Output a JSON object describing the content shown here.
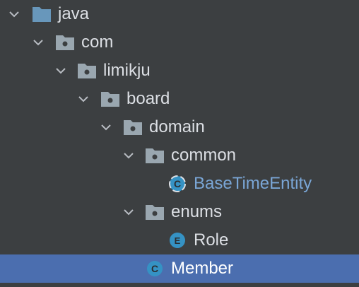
{
  "project_tree": {
    "nodes": [
      {
        "label": "java",
        "icon": "source-folder-icon",
        "expanded": true
      },
      {
        "label": "com",
        "icon": "package-icon",
        "expanded": true
      },
      {
        "label": "limikju",
        "icon": "package-icon",
        "expanded": true
      },
      {
        "label": "board",
        "icon": "package-icon",
        "expanded": true
      },
      {
        "label": "domain",
        "icon": "package-icon",
        "expanded": true
      },
      {
        "label": "common",
        "icon": "package-icon",
        "expanded": true
      },
      {
        "label": "BaseTimeEntity",
        "icon": "abstract-class-icon"
      },
      {
        "label": "enums",
        "icon": "package-icon",
        "expanded": true
      },
      {
        "label": "Role",
        "icon": "enum-icon",
        "glyph": "E"
      },
      {
        "label": "Member",
        "icon": "class-icon",
        "glyph": "C",
        "selected": true
      }
    ]
  },
  "colors": {
    "background": "#3c3f41",
    "selection": "#4b6eaf",
    "text": "#dcdfe4",
    "abstract_class_text": "#7aa6d6",
    "source_folder": "#6897bb",
    "package_folder": "#9aa7b0",
    "class_badge": "#3592c4"
  }
}
